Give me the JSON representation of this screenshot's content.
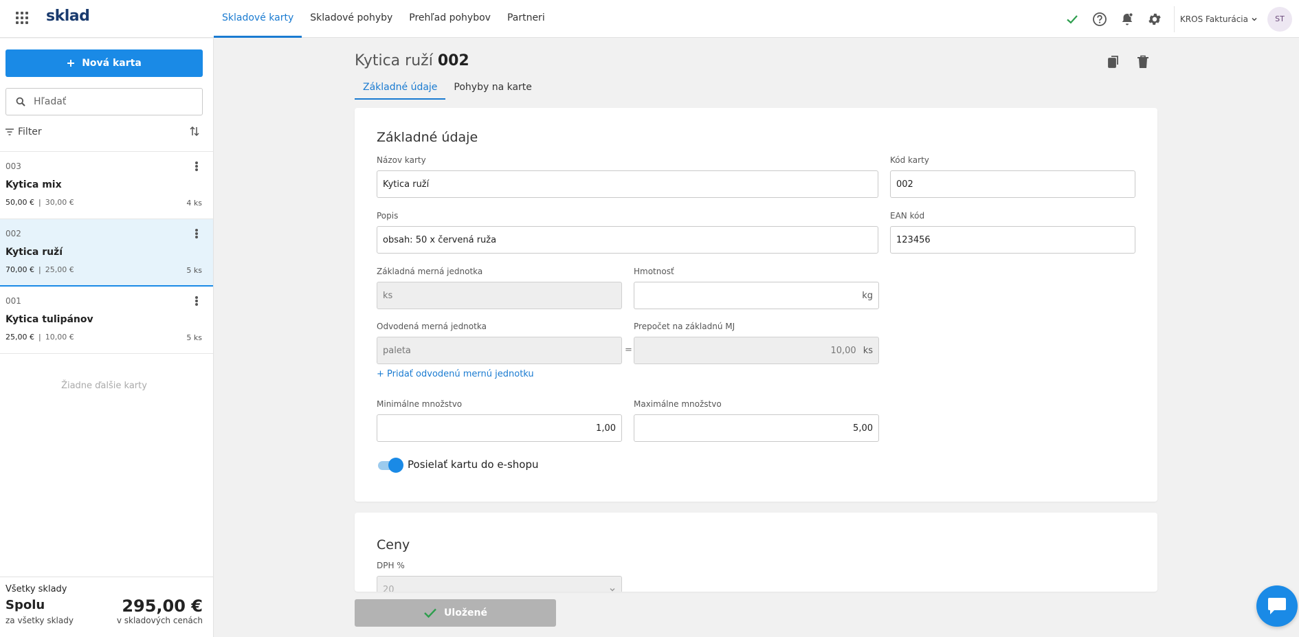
{
  "app": {
    "logo": "sklad"
  },
  "nav": {
    "items": [
      {
        "label": "Skladové karty",
        "active": true
      },
      {
        "label": "Skladové pohyby",
        "active": false
      },
      {
        "label": "Prehľad pohybov",
        "active": false
      },
      {
        "label": "Partneri",
        "active": false
      }
    ]
  },
  "topbar": {
    "company": "KROS Fakturácia",
    "avatar": "ST"
  },
  "sidebar": {
    "new_card_label": "Nová karta",
    "search_placeholder": "Hľadať",
    "filter_label": "Filter",
    "cards": [
      {
        "code": "003",
        "name": "Kytica mix",
        "sell_price": "50,00 €",
        "buy_price": "30,00 €",
        "qty": "4 ks",
        "selected": false
      },
      {
        "code": "002",
        "name": "Kytica ruží",
        "sell_price": "70,00 €",
        "buy_price": "25,00 €",
        "qty": "5 ks",
        "selected": true
      },
      {
        "code": "001",
        "name": "Kytica tulipánov",
        "sell_price": "25,00 €",
        "buy_price": "10,00 €",
        "qty": "5 ks",
        "selected": false
      }
    ],
    "no_more": "Žiadne ďalšie karty",
    "summary": {
      "title": "Všetky sklady",
      "label": "Spolu",
      "sub": "za všetky sklady",
      "amount": "295,00 €",
      "amount_sub": "v skladových cenách"
    }
  },
  "main": {
    "title_prefix": "Kytica ruží",
    "title_code": "002",
    "tabs": [
      {
        "label": "Základné údaje",
        "active": true
      },
      {
        "label": "Pohyby na karte",
        "active": false
      }
    ],
    "basic": {
      "section_title": "Základné údaje",
      "name_label": "Názov karty",
      "name_value": "Kytica ruží",
      "code_label": "Kód karty",
      "code_value": "002",
      "desc_label": "Popis",
      "desc_value": "obsah: 50 x červená ruža",
      "ean_label": "EAN kód",
      "ean_value": "123456",
      "unit_label": "Základná merná jednotka",
      "unit_value": "ks",
      "weight_label": "Hmotnosť",
      "weight_value": "",
      "weight_unit": "kg",
      "derived_label": "Odvodená merná jednotka",
      "derived_value": "paleta",
      "conversion_label": "Prepočet na základnú MJ",
      "conversion_value": "10,00",
      "conversion_unit": "ks",
      "equals": "=",
      "add_derived": "+ Pridať odvodenú mernú jednotku",
      "min_label": "Minimálne množstvo",
      "min_value": "1,00",
      "max_label": "Maximálne množstvo",
      "max_value": "5,00",
      "eshop_label": "Posielať kartu do e-shopu",
      "eshop_enabled": true
    },
    "prices": {
      "section_title": "Ceny",
      "vat_label": "DPH %",
      "vat_value": "20"
    },
    "save_label": "Uložené"
  },
  "colors": {
    "accent": "#1a8ae6",
    "selected_bg": "#e6f3fb",
    "status_ok": "#2e9e4e"
  }
}
